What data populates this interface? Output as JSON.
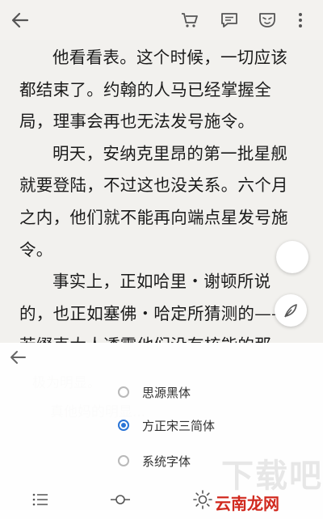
{
  "reader": {
    "paragraphs": [
      "他看看表。这个时候，一切应该都结束了。约翰的人马已经掌握全局，理事会再也无法发号施令。",
      "明天，安纳克里昂的第一批星舰就要登陆，不过这也没关系。六个月之内，他们就不能再向端点星发号施令。",
      "事实上，正如哈里・谢顿所说的，也正如塞佛・哈定所猜测的——若缀克大人透露他们没有核能的那天，哈定心里就已经有数——第一次危机的解决之道，其实极为明显。"
    ],
    "faded_lines": [
      "极为明显。",
      "真他妈的明显..."
    ]
  },
  "font_menu": {
    "options": [
      {
        "label": "思源黑体",
        "selected": false
      },
      {
        "label": "方正宋三简体",
        "selected": true
      },
      {
        "label": "系统字体",
        "selected": false
      }
    ]
  },
  "watermark": {
    "big": "下载吧",
    "small": "云南龙网"
  },
  "colors": {
    "accent": "#2a74d6",
    "background": "#f2f1ee",
    "icon": "#555555"
  },
  "icons": {
    "top": [
      "back-arrow-icon",
      "cart-icon",
      "comment-icon",
      "mask-icon",
      "more-vert-icon"
    ],
    "bottom": [
      "list-icon",
      "progress-icon",
      "brightness-icon"
    ],
    "fab": "feather-pen-icon"
  }
}
